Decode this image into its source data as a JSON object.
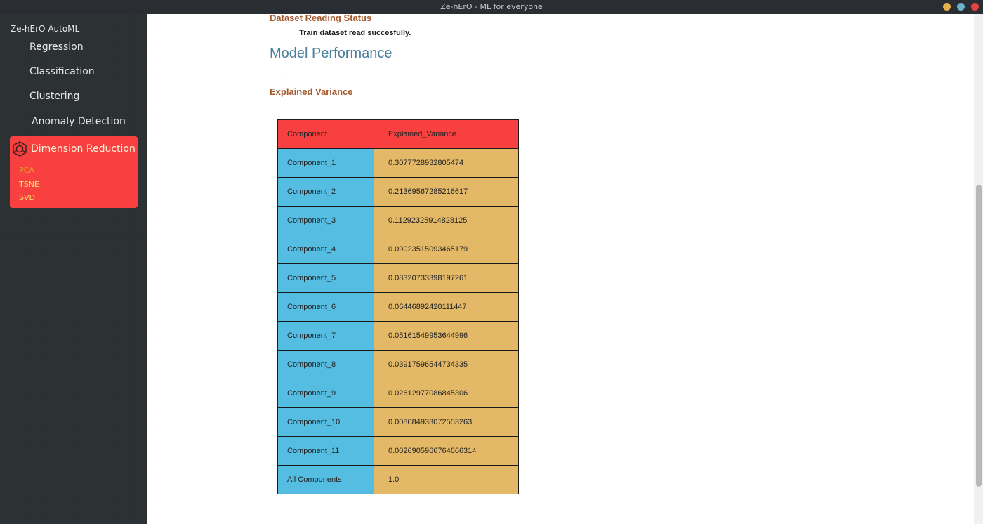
{
  "window": {
    "title": "Ze-hErO - ML for everyone",
    "controls": [
      {
        "name": "minimize",
        "color": "#e6b04a"
      },
      {
        "name": "maximize",
        "color": "#6bb3c9"
      },
      {
        "name": "close",
        "color": "#e04343"
      }
    ]
  },
  "sidebar": {
    "brand": "Ze-hErO AutoML",
    "items": [
      {
        "label": "Regression"
      },
      {
        "label": "Classification"
      },
      {
        "label": "Clustering"
      },
      {
        "label": "Anomaly Detection"
      }
    ],
    "active": {
      "label": "Dimension Reduction",
      "color": "#f94040",
      "subitems": [
        {
          "label": "PCA",
          "color": "#e8a030"
        },
        {
          "label": "TSNE",
          "color": "#f4e36a"
        },
        {
          "label": "SVD",
          "color": "#f4e36a"
        }
      ]
    }
  },
  "main": {
    "dataset_status_heading": "Dataset Reading Status",
    "dataset_status_message": "Train dataset read succesfully.",
    "performance_heading": "Model Performance",
    "placeholder": "...",
    "variance_heading": "Explained Variance",
    "table": {
      "headers": [
        "Component",
        "Explained_Variance"
      ],
      "rows": [
        [
          "Component_1",
          "0.3077728932805474"
        ],
        [
          "Component_2",
          "0.21369567285216617"
        ],
        [
          "Component_3",
          "0.11292325914828125"
        ],
        [
          "Component_4",
          "0.09023515093465179"
        ],
        [
          "Component_5",
          "0.08320733398197261"
        ],
        [
          "Component_6",
          "0.06446892420111447"
        ],
        [
          "Component_7",
          "0.05161549953644996"
        ],
        [
          "Component_8",
          "0.03917596544734335"
        ],
        [
          "Component_9",
          "0.02612977086845306"
        ],
        [
          "Component_10",
          "0.008084933072553263"
        ],
        [
          "Component_11",
          "0.0026905966764666314"
        ],
        [
          "All Components",
          "1.0"
        ]
      ]
    }
  },
  "colors": {
    "header_red": "#f94040",
    "component_blue": "#54bde1",
    "value_gold": "#e3b967",
    "heading_brown": "#a6572a",
    "heading_blue": "#4a7f9b"
  }
}
